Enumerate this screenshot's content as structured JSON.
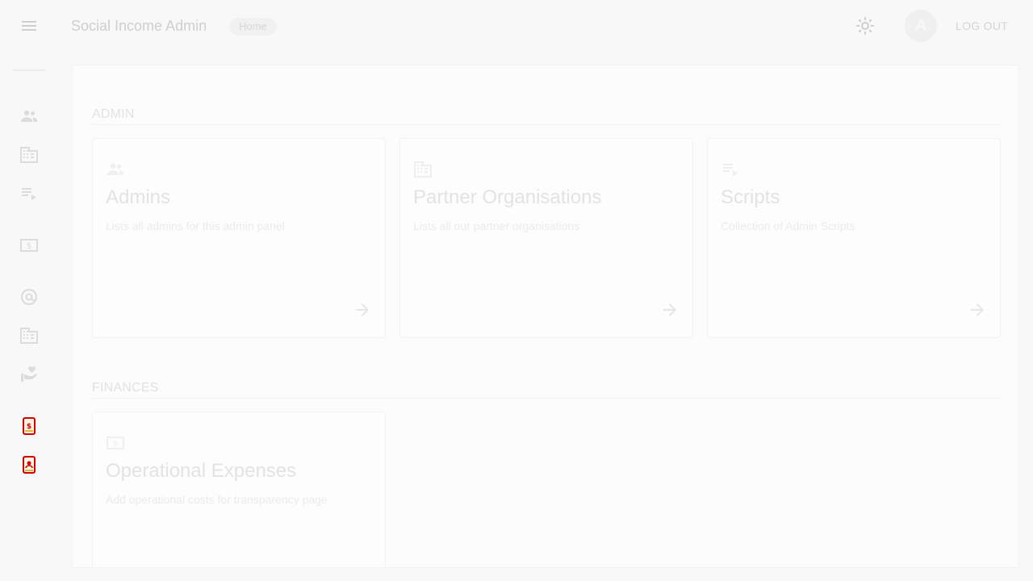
{
  "header": {
    "app_title": "Social Income Admin",
    "breadcrumb": "Home",
    "avatar_initial": "A",
    "logout_label": "LOG OUT"
  },
  "sidebar": {
    "icons": [
      "admins-icon",
      "organisations-icon",
      "scripts-icon",
      "expenses-icon",
      "contributors-icon",
      "partner-orgs-icon",
      "recipients-icon",
      "surveys-icon",
      "payments-icon"
    ]
  },
  "sections": [
    {
      "title": "ADMIN",
      "cards": [
        {
          "title": "Admins",
          "description": "Lists all admins for this admin panel",
          "icon": "admins-icon"
        },
        {
          "title": "Partner Organisations",
          "description": "Lists all our partner organisations",
          "icon": "organisation-icon"
        },
        {
          "title": "Scripts",
          "description": "Collection of Admin Scripts",
          "icon": "playlist-icon"
        }
      ]
    },
    {
      "title": "FINANCES",
      "cards": [
        {
          "title": "Operational Expenses",
          "description": "Add operational costs for transparency page",
          "icon": "money-icon"
        }
      ]
    }
  ],
  "colors": {
    "background": "#f8f8f8",
    "panel": "#fcfcfc",
    "icon_gray": "#dcdcdc",
    "accent_red": "#d40000"
  }
}
